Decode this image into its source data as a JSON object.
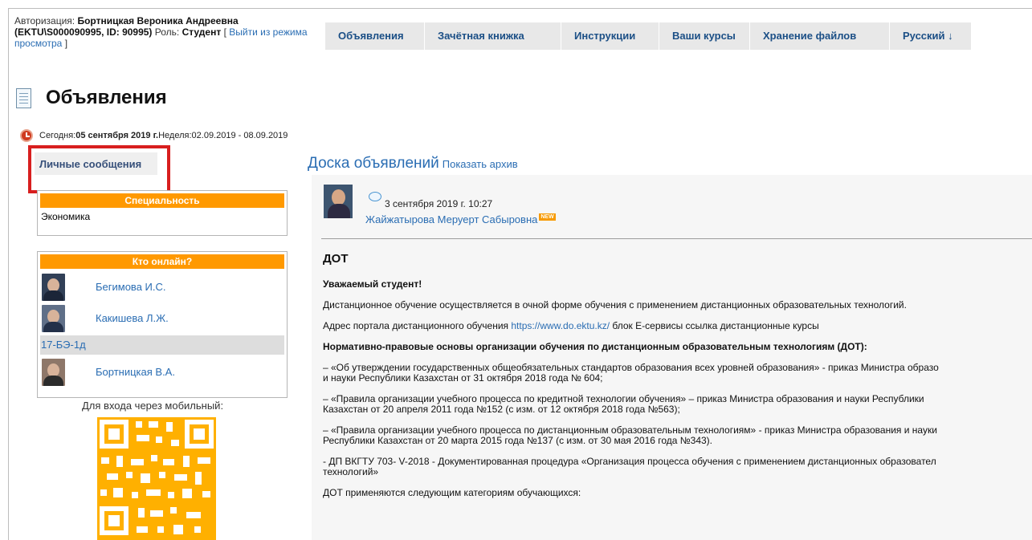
{
  "auth": {
    "prefix": "Авторизация: ",
    "name": "Бортницкая Вероника Андреевна",
    "id": "(EKTU\\S000090995, ID: 90995)",
    "role_label": " Роль: ",
    "role": "Студент",
    "bracket_open": " [ ",
    "exit_link": "Выйти из режима просмотра",
    "bracket_close": " ]"
  },
  "nav": {
    "items": [
      "Объявления",
      "Зачётная книжка",
      "Инструкции",
      "Ваши курсы",
      "Хранение файлов",
      "Русский ↓"
    ]
  },
  "page": {
    "title": "Объявления"
  },
  "date": {
    "today_label": "Сегодня: ",
    "today_value": "05 сентября 2019 г.",
    "week_label": " Неделя: ",
    "week_value": "02.09.2019 - 08.09.2019"
  },
  "sidebar": {
    "personal_messages": "Личные сообщения",
    "specialty_title": "Специальность",
    "specialty_value": "Экономика",
    "online_title": "Кто онлайн?",
    "online_users": [
      "Бегимова И.С.",
      "Какишева Л.Ж.",
      "Бортницкая В.А."
    ],
    "group": "17-БЭ-1д",
    "mobile_label": "Для входа через мобильный:"
  },
  "board": {
    "title": "Доска объявлений",
    "archive_link": "Показать архив",
    "post_date": "3 сентября 2019 г. 10:27",
    "author": "Жайжатырова Меруерт Сабыровна",
    "new_badge": "NEW",
    "heading": "ДОТ",
    "greeting": "Уважаемый студент!",
    "paragraph1": "Дистанционное обучение осуществляется в очной форме обучения с применением дистанционных образовательных технологий.",
    "portal_prefix": "Адрес портала дистанционного обучения ",
    "portal_link": "https://www.do.ektu.kz/",
    "portal_suffix": " блок Е-сервисы ссылка дистанционные курсы",
    "legal_title": "Нормативно-правовые основы организации обучения по дистанционным образовательным технологиям (ДОТ):",
    "item1_line1": "– «Об утверждении государственных общеобязательных стандартов образования всех уровней образования» - приказ Министра образо",
    "item1_line2": "и науки Республики Казахстан от 31 октября 2018 года № 604;",
    "item2_line1": "– «Правила организации учебного процесса по кредитной технологии обучения» – приказ Министра образования и науки Республики",
    "item2_line2": "Казахстан от 20 апреля 2011 года №152 (с изм. от 12 октября 2018 года №563);",
    "item3_line1": "– «Правила организации учебного процесса по дистанционным образовательным технологиям» - приказ Министра образования и науки",
    "item3_line2": "Республики Казахстан от 20 марта 2015 года №137 (с изм. от 30 мая 2016 года №343).",
    "item4_line1": "-  ДП ВКГТУ 703- V-2018 - Документированная процедура «Организация процесса обучения с применением дистанционных образовател",
    "item4_line2": "технологий»",
    "bottom_cut": "ДОТ применяются следующим категориям обучающихся:"
  },
  "colors": {
    "accent": "#ff9900",
    "link": "#2a6db3",
    "highlight": "#d81f1f",
    "panel": "#f6f6f6"
  }
}
